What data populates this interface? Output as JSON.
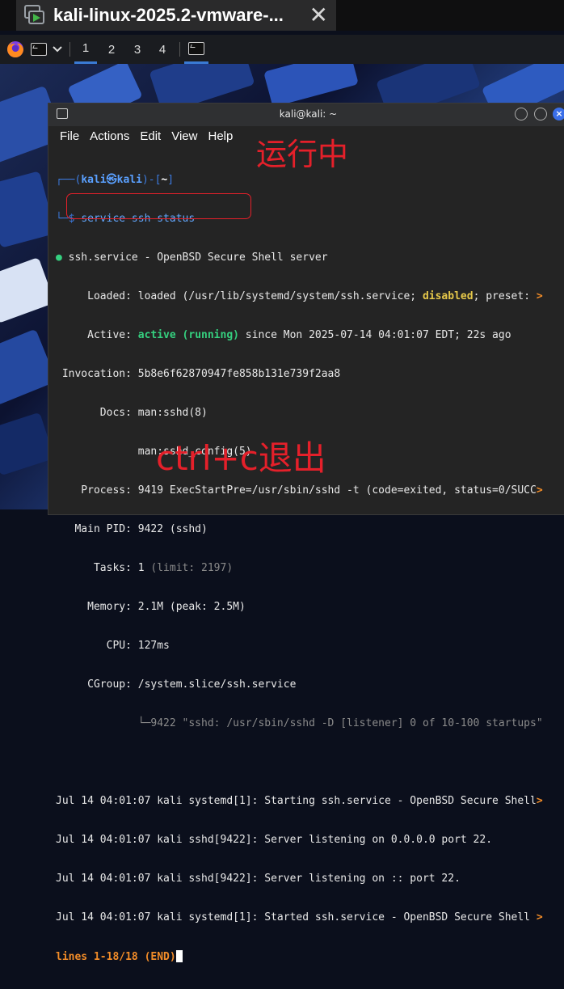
{
  "vm_tab": {
    "title": "kali-linux-2025.2-vmware-...",
    "close_glyph": "✕"
  },
  "panel": {
    "workspaces": [
      "1",
      "2",
      "3",
      "4"
    ],
    "dropdown_glyph": "⌄"
  },
  "terminal": {
    "title": "kali@kali: ~",
    "menu": [
      "File",
      "Actions",
      "Edit",
      "View",
      "Help"
    ],
    "prompt": {
      "open": "┌──(",
      "user": "kali㉿kali",
      "mid": ")-[",
      "dir": "~",
      "close": "]",
      "arrow": "└─$",
      "command": "service ssh status"
    },
    "lines": {
      "unit_header": "● ssh.service - OpenBSD Secure Shell server",
      "loaded_label": "     Loaded: ",
      "loaded_value": "loaded (/usr/lib/systemd/system/ssh.service; ",
      "loaded_disabled": "disabled",
      "loaded_rest": "; preset: ",
      "active_label": "     Active: ",
      "active_value": "active (running)",
      "active_rest": " since Mon 2025-07-14 04:01:07 EDT; 22s ago",
      "invocation": " Invocation: 5b8e6f62870947fe858b131e739f2aa8",
      "docs_1": "       Docs: man:sshd(8)",
      "docs_2": "             man:sshd_config(5)",
      "process": "    Process: 9419 ExecStartPre=/usr/sbin/sshd -t (code=exited, status=0/SUCC",
      "main_pid": "   Main PID: 9422 (sshd)",
      "tasks_label": "      Tasks: 1 ",
      "tasks_limit": "(limit: 2197)",
      "memory": "     Memory: 2.1M (peak: 2.5M)",
      "cpu": "        CPU: 127ms",
      "cgroup": "     CGroup: /system.slice/ssh.service",
      "cgroup_child": "             └─9422 \"sshd: /usr/sbin/sshd -D [listener] 0 of 10-100 startups\"",
      "log_1": "Jul 14 04:01:07 kali systemd[1]: Starting ssh.service - OpenBSD Secure Shell",
      "log_2": "Jul 14 04:01:07 kali sshd[9422]: Server listening on 0.0.0.0 port 22.",
      "log_3": "Jul 14 04:01:07 kali sshd[9422]: Server listening on :: port 22.",
      "log_4": "Jul 14 04:01:07 kali systemd[1]: Started ssh.service - OpenBSD Secure Shell ",
      "pager_status": "lines 1-18/18 (END)",
      "truncation_marker": ">"
    }
  },
  "annotations": {
    "running": "运行中",
    "exit_hint": "ctrl+c退出"
  },
  "colors": {
    "accent_blue": "#3c7be0",
    "status_green": "#35d07f",
    "disabled_yellow": "#e6c84a",
    "pager_orange": "#f28c28",
    "annotation_red": "#e5202a"
  },
  "icons": [
    "vmware-vm-icon",
    "firefox-icon",
    "terminal-icon"
  ]
}
